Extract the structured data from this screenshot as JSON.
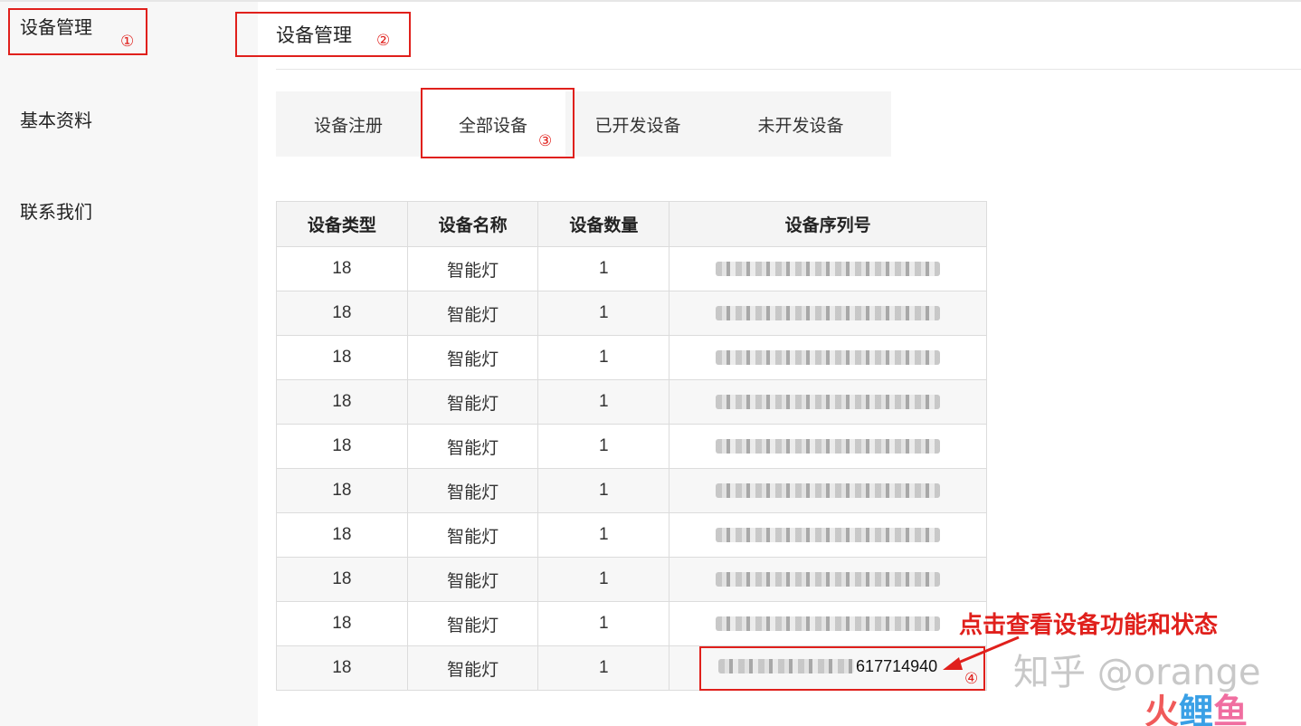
{
  "sidebar": {
    "items": [
      {
        "label": "设备管理",
        "active": true
      },
      {
        "label": "基本资料"
      },
      {
        "label": "联系我们"
      }
    ]
  },
  "header": {
    "title": "设备管理"
  },
  "tabs": [
    {
      "label": "设备注册"
    },
    {
      "label": "全部设备",
      "active": true
    },
    {
      "label": "已开发设备"
    },
    {
      "label": "未开发设备"
    }
  ],
  "table": {
    "columns": [
      "设备类型",
      "设备名称",
      "设备数量",
      "设备序列号"
    ],
    "rows": [
      {
        "type": "18",
        "name": "智能灯",
        "count": "1",
        "serial": ""
      },
      {
        "type": "18",
        "name": "智能灯",
        "count": "1",
        "serial": ""
      },
      {
        "type": "18",
        "name": "智能灯",
        "count": "1",
        "serial": ""
      },
      {
        "type": "18",
        "name": "智能灯",
        "count": "1",
        "serial": ""
      },
      {
        "type": "18",
        "name": "智能灯",
        "count": "1",
        "serial": ""
      },
      {
        "type": "18",
        "name": "智能灯",
        "count": "1",
        "serial": ""
      },
      {
        "type": "18",
        "name": "智能灯",
        "count": "1",
        "serial": ""
      },
      {
        "type": "18",
        "name": "智能灯",
        "count": "1",
        "serial": ""
      },
      {
        "type": "18",
        "name": "智能灯",
        "count": "1",
        "serial": ""
      },
      {
        "type": "18",
        "name": "智能灯",
        "count": "1",
        "serial_tail": "617714940"
      }
    ]
  },
  "annotations": {
    "marker_1": "①",
    "marker_2": "②",
    "marker_3": "③",
    "marker_4": "④",
    "callout": "点击查看设备功能和状态",
    "color": "#e0201c"
  },
  "watermark": {
    "zhihu": "知乎 @orange",
    "logo": [
      "火",
      "鲤",
      "鱼"
    ]
  }
}
